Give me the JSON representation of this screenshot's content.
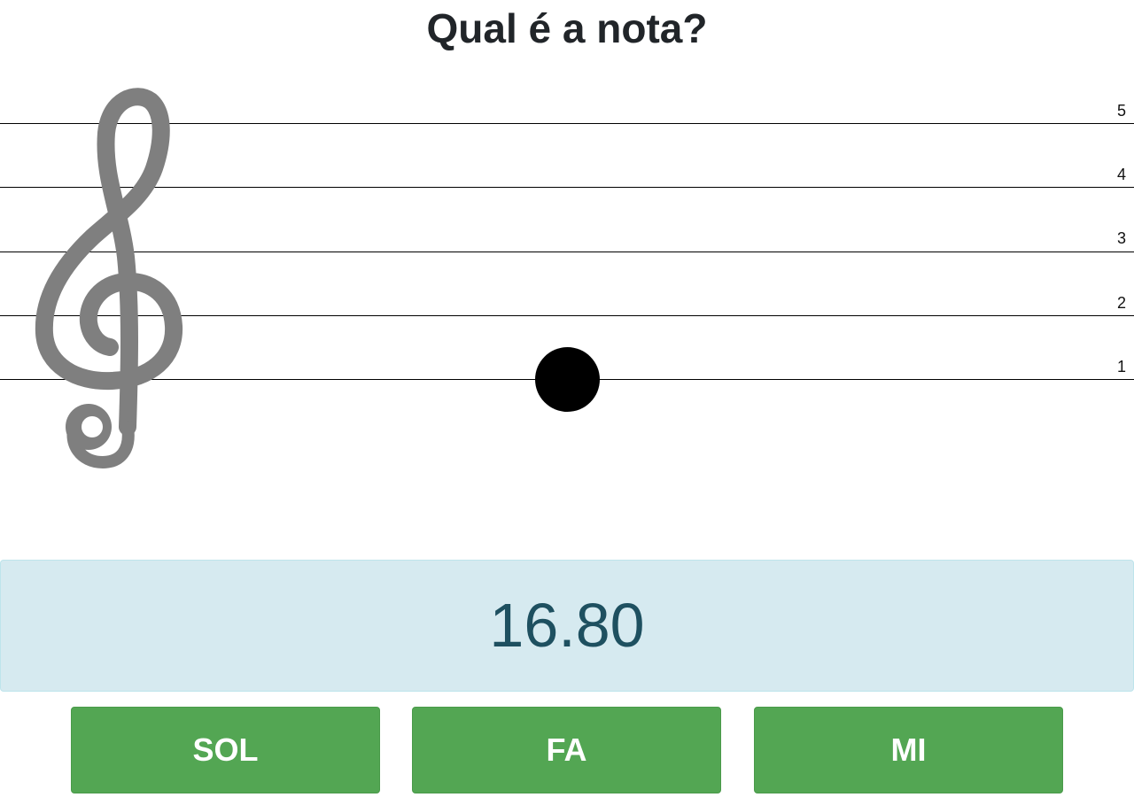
{
  "header": {
    "title": "Qual é a nota?"
  },
  "staff": {
    "line_numbers": [
      "5",
      "4",
      "3",
      "2",
      "1"
    ],
    "clef_icon": "treble-clef-icon",
    "clef_color": "#7f7f7f",
    "note_color": "#000000"
  },
  "timer": {
    "value": "16.80",
    "background": "#d6eaf0",
    "text_color": "#1e5060"
  },
  "answers": {
    "color": "#53a653",
    "options": [
      {
        "label": "SOL"
      },
      {
        "label": "FA"
      },
      {
        "label": "MI"
      }
    ]
  }
}
